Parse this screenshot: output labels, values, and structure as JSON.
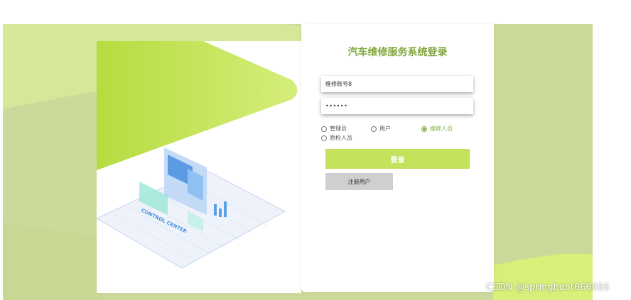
{
  "login": {
    "title": "汽车维修服务系统登录",
    "account_value": "维修账号8",
    "password_value": "••••••",
    "roles": [
      "管理员",
      "用户",
      "维修人员",
      "质检人员"
    ],
    "selected_role": "维修人员",
    "login_button": "登录",
    "register_button": "注册用户"
  },
  "illustration": {
    "caption": "CONTROL CENTER"
  },
  "watermark": "CSDN @springboot666666",
  "colors": {
    "accent_green": "#7da83a",
    "button_green": "#c4e25c",
    "background": "#cbd99a",
    "register_gray": "#cfcfcf"
  }
}
